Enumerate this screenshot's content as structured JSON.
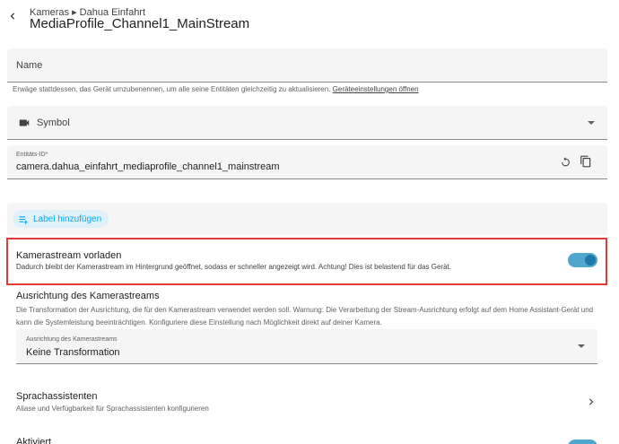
{
  "header": {
    "breadcrumb": "Kameras ▸ Dahua Einfahrt",
    "title": "MediaProfile_Channel1_MainStream"
  },
  "name_field": {
    "placeholder": "Name"
  },
  "rename_hint": {
    "text": "Erwäge stattdessen, das Gerät umzubenennen, um alle seine Entitäten gleichzeitig zu aktualisieren. ",
    "link": "Geräteeinstellungen öffnen"
  },
  "symbol_field": {
    "placeholder": "Symbol",
    "icon": "video-camera-icon"
  },
  "entity_id_field": {
    "label": "Entitäts-ID*",
    "value": "camera.dahua_einfahrt_mediaprofile_channel1_mainstream"
  },
  "label_chip": {
    "text": "Label hinzufügen"
  },
  "preload_stream": {
    "title": "Kamerastream vorladen",
    "description": "Dadurch bleibt der Kamerastream im Hintergrund geöffnet, sodass er schneller angezeigt wird. Achtung! Dies ist belastend für das Gerät.",
    "enabled": true
  },
  "stream_orientation": {
    "title": "Ausrichtung des Kamerastreams",
    "description": "Die Transformation der Ausrichtung, die für den Kamerastream verwendet werden soll. Warnung: Die Verarbeitung der Stream-Ausrichtung erfolgt auf dem Home Assistant-Gerät und kann die Systemleistung beeinträchtigen. Konfiguriere diese Einstellung nach Möglichkeit direkt auf deiner Kamera.",
    "select_label": "Ausrichtung des Kamerastreams",
    "select_value": "Keine Transformation"
  },
  "voice_assistants": {
    "title": "Sprachassistenten",
    "description": "Aliase und Verfügbarkeit für Sprachassistenten konfigurieren"
  },
  "enabled_row": {
    "title": "Aktiviert"
  },
  "colors": {
    "accent": "#03a9f4",
    "toggle_track": "#4fa6cf",
    "toggle_knob": "#1e78a8",
    "highlight": "#e53935"
  }
}
